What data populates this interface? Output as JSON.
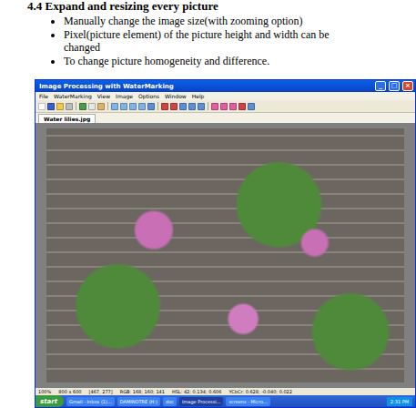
{
  "heading": "4.4 Expand and resizing every picture",
  "bullets": [
    "Manually change  the image size(with zooming option)",
    "Pixel(picture element) of the  picture height and width can be changed",
    "To change picture homogeneity and difference."
  ],
  "app": {
    "title": "Image Processing with WaterMarking",
    "window_buttons": [
      "_",
      "□",
      "×"
    ],
    "menu": [
      "File",
      "WaterMarking",
      "View",
      "Image",
      "Options",
      "Window",
      "Help"
    ],
    "toolbar": [
      {
        "kind": "new"
      },
      {
        "kind": "save"
      },
      {
        "kind": "open"
      },
      {
        "kind": "print"
      },
      {
        "kind": "sep"
      },
      {
        "kind": "undo"
      },
      {
        "kind": "copy"
      },
      {
        "kind": "paste"
      },
      {
        "kind": "sep"
      },
      {
        "kind": "zoom"
      },
      {
        "kind": "zoom"
      },
      {
        "kind": "zoom"
      },
      {
        "kind": "zoom"
      },
      {
        "kind": "grid"
      },
      {
        "kind": "sep"
      },
      {
        "kind": "tool"
      },
      {
        "kind": "tool"
      },
      {
        "kind": "grid"
      },
      {
        "kind": "grid"
      },
      {
        "kind": "grid"
      },
      {
        "kind": "sep"
      },
      {
        "kind": "color"
      },
      {
        "kind": "color"
      },
      {
        "kind": "color"
      },
      {
        "kind": "tool"
      },
      {
        "kind": "grid"
      }
    ],
    "tabs": [
      {
        "label": "Water lilies.jpg",
        "selected": true
      }
    ],
    "status_bar": [
      "100%",
      "800 x 600",
      "[467, 277]",
      "RGB: 168; 160; 141",
      "HSL: 42; 0.134; 0.606",
      "YCbCr: 0.628; -0.040; 0.022"
    ]
  },
  "taskbar": {
    "start": "start",
    "items": [
      {
        "label": "Gmail - Inbox (1)...",
        "selected": false
      },
      {
        "label": "DAMINOTRE (H:)",
        "selected": false
      },
      {
        "label": "doc",
        "selected": false
      },
      {
        "label": "Image Processi...",
        "selected": true
      },
      {
        "label": "screens - Micro...",
        "selected": false
      }
    ],
    "clock": "2:31 PM"
  }
}
